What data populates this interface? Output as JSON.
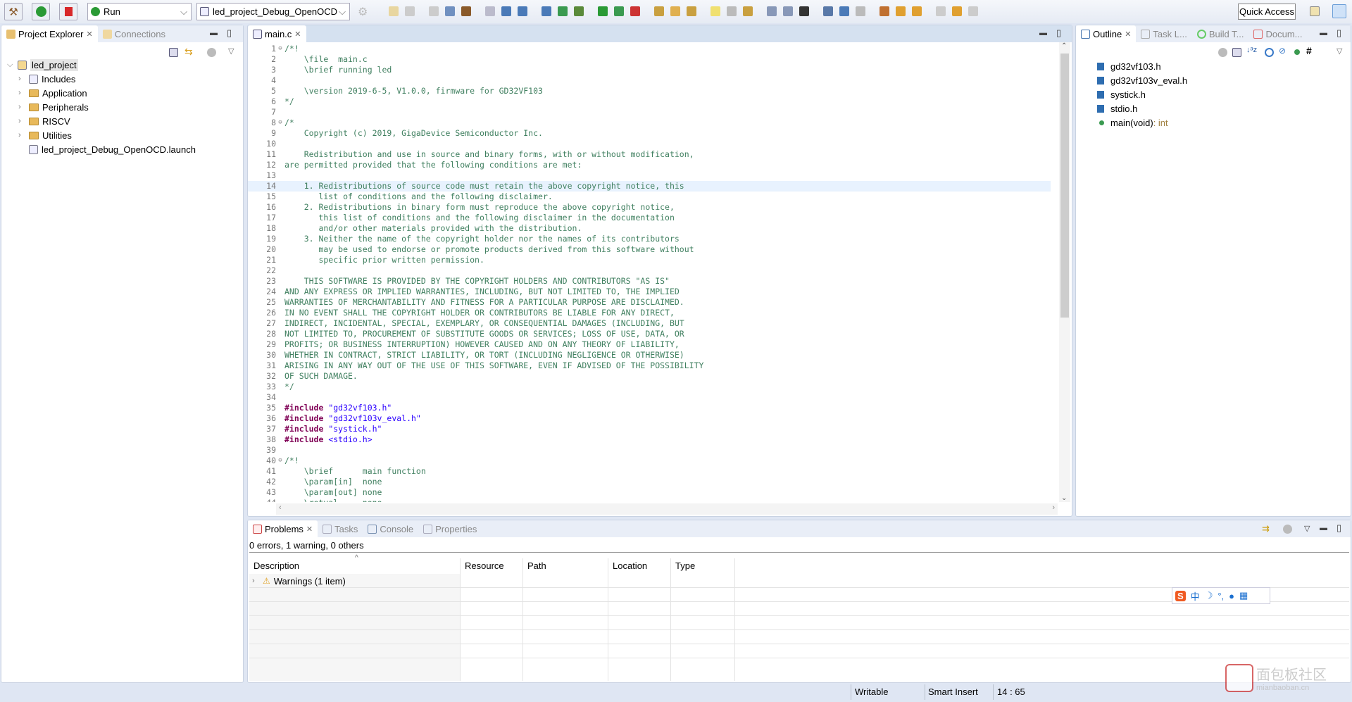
{
  "toolbar": {
    "run_config": "Run",
    "launch_config": "led_project_Debug_OpenOCD",
    "quick_access": "Quick Access"
  },
  "left_panel": {
    "tabs": [
      {
        "label": "Project Explorer"
      },
      {
        "label": "Connections"
      }
    ],
    "tree": [
      {
        "label": "led_project",
        "level": 0,
        "expanded": true,
        "icon": "c-project-icon"
      },
      {
        "label": "Includes",
        "level": 1,
        "icon": "includes-icon"
      },
      {
        "label": "Application",
        "level": 1,
        "icon": "folder-icon"
      },
      {
        "label": "Peripherals",
        "level": 1,
        "icon": "folder-icon"
      },
      {
        "label": "RISCV",
        "level": 1,
        "icon": "folder-icon"
      },
      {
        "label": "Utilities",
        "level": 1,
        "icon": "folder-icon"
      },
      {
        "label": "led_project_Debug_OpenOCD.launch",
        "level": 1,
        "icon": "file-icon"
      }
    ]
  },
  "editor": {
    "tab": "main.c",
    "current_line": 14,
    "lines": [
      {
        "t": "/*!",
        "f": 1
      },
      {
        "t": "    \\file  main.c"
      },
      {
        "t": "    \\brief running led"
      },
      {
        "t": ""
      },
      {
        "t": "    \\version 2019-6-5, V1.0.0, firmware for GD32VF103"
      },
      {
        "t": "*/"
      },
      {
        "t": ""
      },
      {
        "t": "/*",
        "f": 1
      },
      {
        "t": "    Copyright (c) 2019, GigaDevice Semiconductor Inc."
      },
      {
        "t": ""
      },
      {
        "t": "    Redistribution and use in source and binary forms, with or without modification,"
      },
      {
        "t": "are permitted provided that the following conditions are met:"
      },
      {
        "t": ""
      },
      {
        "t": "    1. Redistributions of source code must retain the above copyright notice, this"
      },
      {
        "t": "       list of conditions and the following disclaimer."
      },
      {
        "t": "    2. Redistributions in binary form must reproduce the above copyright notice,"
      },
      {
        "t": "       this list of conditions and the following disclaimer in the documentation"
      },
      {
        "t": "       and/or other materials provided with the distribution."
      },
      {
        "t": "    3. Neither the name of the copyright holder nor the names of its contributors"
      },
      {
        "t": "       may be used to endorse or promote products derived from this software without"
      },
      {
        "t": "       specific prior written permission."
      },
      {
        "t": ""
      },
      {
        "t": "    THIS SOFTWARE IS PROVIDED BY THE COPYRIGHT HOLDERS AND CONTRIBUTORS \"AS IS\""
      },
      {
        "t": "AND ANY EXPRESS OR IMPLIED WARRANTIES, INCLUDING, BUT NOT LIMITED TO, THE IMPLIED"
      },
      {
        "t": "WARRANTIES OF MERCHANTABILITY AND FITNESS FOR A PARTICULAR PURPOSE ARE DISCLAIMED."
      },
      {
        "t": "IN NO EVENT SHALL THE COPYRIGHT HOLDER OR CONTRIBUTORS BE LIABLE FOR ANY DIRECT,"
      },
      {
        "t": "INDIRECT, INCIDENTAL, SPECIAL, EXEMPLARY, OR CONSEQUENTIAL DAMAGES (INCLUDING, BUT"
      },
      {
        "t": "NOT LIMITED TO, PROCUREMENT OF SUBSTITUTE GOODS OR SERVICES; LOSS OF USE, DATA, OR"
      },
      {
        "t": "PROFITS; OR BUSINESS INTERRUPTION) HOWEVER CAUSED AND ON ANY THEORY OF LIABILITY,"
      },
      {
        "t": "WHETHER IN CONTRACT, STRICT LIABILITY, OR TORT (INCLUDING NEGLIGENCE OR OTHERWISE)"
      },
      {
        "t": "ARISING IN ANY WAY OUT OF THE USE OF THIS SOFTWARE, EVEN IF ADVISED OF THE POSSIBILITY"
      },
      {
        "t": "OF SUCH DAMAGE."
      },
      {
        "t": "*/"
      },
      {
        "t": ""
      },
      {
        "kw": "#include",
        "s": " \"gd32vf103.h\""
      },
      {
        "kw": "#include",
        "s": " \"gd32vf103v_eval.h\""
      },
      {
        "kw": "#include",
        "s": " \"systick.h\""
      },
      {
        "kw": "#include",
        "s": " <stdio.h>"
      },
      {
        "t": ""
      },
      {
        "t": "/*!",
        "f": 1
      },
      {
        "t": "    \\brief      main function"
      },
      {
        "t": "    \\param[in]  none"
      },
      {
        "t": "    \\param[out] none"
      },
      {
        "t": "    \\retval     none"
      }
    ]
  },
  "outline": {
    "tabs": [
      {
        "label": "Outline"
      },
      {
        "label": "Task L..."
      },
      {
        "label": "Build T..."
      },
      {
        "label": "Docum..."
      }
    ],
    "items": [
      {
        "label": "gd32vf103.h",
        "icon": "include-icon"
      },
      {
        "label": "gd32vf103v_eval.h",
        "icon": "include-icon"
      },
      {
        "label": "systick.h",
        "icon": "include-icon"
      },
      {
        "label": "stdio.h",
        "icon": "include-icon"
      },
      {
        "label": "main(void)",
        "type": " : int",
        "icon": "function-icon"
      }
    ]
  },
  "problems": {
    "tabs": [
      {
        "label": "Problems"
      },
      {
        "label": "Tasks"
      },
      {
        "label": "Console"
      },
      {
        "label": "Properties"
      }
    ],
    "summary": "0 errors, 1 warning, 0 others",
    "columns": [
      "Description",
      "Resource",
      "Path",
      "Location",
      "Type"
    ],
    "rows": [
      {
        "label": "Warnings (1 item)"
      }
    ]
  },
  "status": {
    "writable": "Writable",
    "insert_mode": "Smart Insert",
    "position": "14 : 65"
  },
  "colors": {
    "comment": "#3f7f5f",
    "keyword": "#7f0055",
    "string": "#2a00ff",
    "current_line": "#e8f2fe"
  },
  "watermark": {
    "text": "面包板社区",
    "sub": "mianbaoban.cn"
  }
}
